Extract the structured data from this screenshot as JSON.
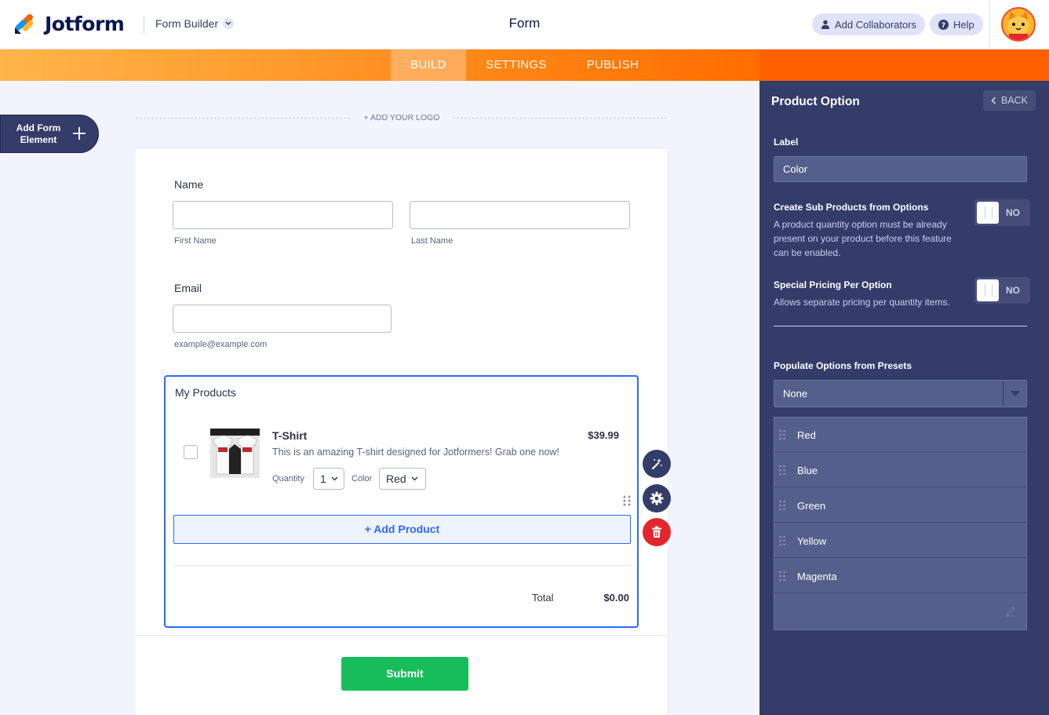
{
  "header": {
    "brand": "Jotform",
    "mode": "Form Builder",
    "title": "Form",
    "collaborators_label": "Add Collaborators",
    "help_label": "Help"
  },
  "nav": {
    "tabs": [
      {
        "label": "BUILD",
        "active": true
      },
      {
        "label": "SETTINGS",
        "active": false
      },
      {
        "label": "PUBLISH",
        "active": false
      }
    ]
  },
  "sidebar": {
    "add_element_label": "Add Form Element"
  },
  "form": {
    "add_logo": "+ ADD YOUR LOGO",
    "name_label": "Name",
    "first_name_sublabel": "First Name",
    "last_name_sublabel": "Last Name",
    "email_label": "Email",
    "email_sublabel": "example@example.com",
    "products": {
      "title": "My Products",
      "item": {
        "name": "T-Shirt",
        "price": "$39.99",
        "description": "This is an amazing T-shirt designed for Jotformers! Grab one now!",
        "quantity_label": "Quantity",
        "quantity_value": "1",
        "color_label": "Color",
        "color_value": "Red"
      },
      "add_product_label": "+ Add Product",
      "total_label": "Total",
      "total_value": "$0.00"
    },
    "submit_label": "Submit"
  },
  "panel": {
    "title": "Product Option",
    "back_label": "BACK",
    "label_field_title": "Label",
    "label_field_value": "Color",
    "sub_products_title": "Create Sub Products from Options",
    "sub_products_desc": "A product quantity option must be already present on your product before this feature can be enabled.",
    "sub_products_toggle": "NO",
    "special_pricing_title": "Special Pricing Per Option",
    "special_pricing_desc": "Allows separate pricing per quantity items.",
    "special_pricing_toggle": "NO",
    "presets_title": "Populate Options from Presets",
    "presets_value": "None",
    "options": [
      "Red",
      "Blue",
      "Green",
      "Yellow",
      "Magenta"
    ]
  },
  "colors": {
    "brand_orange": "#ff6100",
    "panel_bg": "#343c6a",
    "accent_blue": "#2e69ff",
    "submit_green": "#18bd5b",
    "delete_red": "#e3262c"
  },
  "icons": {
    "logo": "jotform-logo-icon",
    "chevron": "chevron-down-icon",
    "user": "user-icon",
    "help": "question-icon",
    "avatar": "podo-avatar",
    "wand": "magic-wand-icon",
    "gear": "gear-icon",
    "trash": "trash-icon",
    "drag": "drag-handle-icon",
    "pencil": "pencil-icon",
    "back": "chevron-left-icon"
  }
}
